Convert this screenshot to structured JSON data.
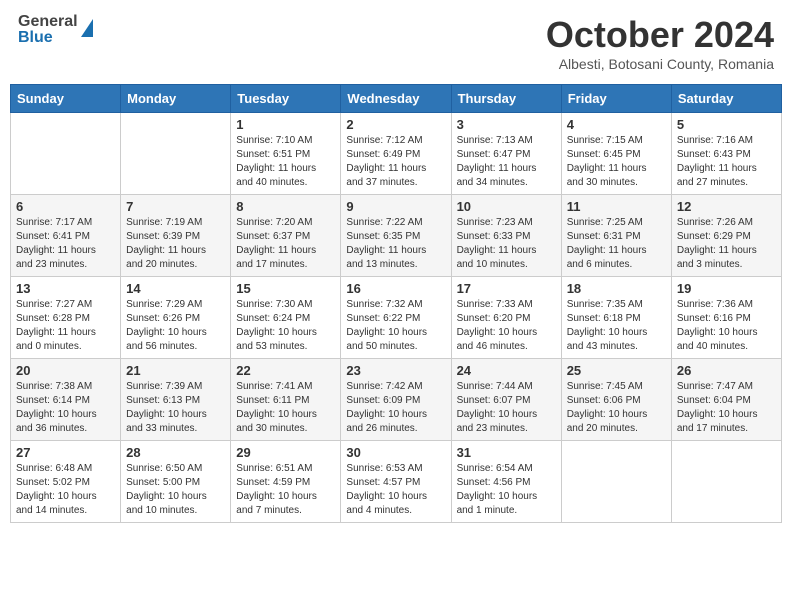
{
  "header": {
    "logo_general": "General",
    "logo_blue": "Blue",
    "month_title": "October 2024",
    "subtitle": "Albesti, Botosani County, Romania"
  },
  "weekdays": [
    "Sunday",
    "Monday",
    "Tuesday",
    "Wednesday",
    "Thursday",
    "Friday",
    "Saturday"
  ],
  "weeks": [
    [
      {
        "day": "",
        "info": ""
      },
      {
        "day": "",
        "info": ""
      },
      {
        "day": "1",
        "info": "Sunrise: 7:10 AM\nSunset: 6:51 PM\nDaylight: 11 hours and 40 minutes."
      },
      {
        "day": "2",
        "info": "Sunrise: 7:12 AM\nSunset: 6:49 PM\nDaylight: 11 hours and 37 minutes."
      },
      {
        "day": "3",
        "info": "Sunrise: 7:13 AM\nSunset: 6:47 PM\nDaylight: 11 hours and 34 minutes."
      },
      {
        "day": "4",
        "info": "Sunrise: 7:15 AM\nSunset: 6:45 PM\nDaylight: 11 hours and 30 minutes."
      },
      {
        "day": "5",
        "info": "Sunrise: 7:16 AM\nSunset: 6:43 PM\nDaylight: 11 hours and 27 minutes."
      }
    ],
    [
      {
        "day": "6",
        "info": "Sunrise: 7:17 AM\nSunset: 6:41 PM\nDaylight: 11 hours and 23 minutes."
      },
      {
        "day": "7",
        "info": "Sunrise: 7:19 AM\nSunset: 6:39 PM\nDaylight: 11 hours and 20 minutes."
      },
      {
        "day": "8",
        "info": "Sunrise: 7:20 AM\nSunset: 6:37 PM\nDaylight: 11 hours and 17 minutes."
      },
      {
        "day": "9",
        "info": "Sunrise: 7:22 AM\nSunset: 6:35 PM\nDaylight: 11 hours and 13 minutes."
      },
      {
        "day": "10",
        "info": "Sunrise: 7:23 AM\nSunset: 6:33 PM\nDaylight: 11 hours and 10 minutes."
      },
      {
        "day": "11",
        "info": "Sunrise: 7:25 AM\nSunset: 6:31 PM\nDaylight: 11 hours and 6 minutes."
      },
      {
        "day": "12",
        "info": "Sunrise: 7:26 AM\nSunset: 6:29 PM\nDaylight: 11 hours and 3 minutes."
      }
    ],
    [
      {
        "day": "13",
        "info": "Sunrise: 7:27 AM\nSunset: 6:28 PM\nDaylight: 11 hours and 0 minutes."
      },
      {
        "day": "14",
        "info": "Sunrise: 7:29 AM\nSunset: 6:26 PM\nDaylight: 10 hours and 56 minutes."
      },
      {
        "day": "15",
        "info": "Sunrise: 7:30 AM\nSunset: 6:24 PM\nDaylight: 10 hours and 53 minutes."
      },
      {
        "day": "16",
        "info": "Sunrise: 7:32 AM\nSunset: 6:22 PM\nDaylight: 10 hours and 50 minutes."
      },
      {
        "day": "17",
        "info": "Sunrise: 7:33 AM\nSunset: 6:20 PM\nDaylight: 10 hours and 46 minutes."
      },
      {
        "day": "18",
        "info": "Sunrise: 7:35 AM\nSunset: 6:18 PM\nDaylight: 10 hours and 43 minutes."
      },
      {
        "day": "19",
        "info": "Sunrise: 7:36 AM\nSunset: 6:16 PM\nDaylight: 10 hours and 40 minutes."
      }
    ],
    [
      {
        "day": "20",
        "info": "Sunrise: 7:38 AM\nSunset: 6:14 PM\nDaylight: 10 hours and 36 minutes."
      },
      {
        "day": "21",
        "info": "Sunrise: 7:39 AM\nSunset: 6:13 PM\nDaylight: 10 hours and 33 minutes."
      },
      {
        "day": "22",
        "info": "Sunrise: 7:41 AM\nSunset: 6:11 PM\nDaylight: 10 hours and 30 minutes."
      },
      {
        "day": "23",
        "info": "Sunrise: 7:42 AM\nSunset: 6:09 PM\nDaylight: 10 hours and 26 minutes."
      },
      {
        "day": "24",
        "info": "Sunrise: 7:44 AM\nSunset: 6:07 PM\nDaylight: 10 hours and 23 minutes."
      },
      {
        "day": "25",
        "info": "Sunrise: 7:45 AM\nSunset: 6:06 PM\nDaylight: 10 hours and 20 minutes."
      },
      {
        "day": "26",
        "info": "Sunrise: 7:47 AM\nSunset: 6:04 PM\nDaylight: 10 hours and 17 minutes."
      }
    ],
    [
      {
        "day": "27",
        "info": "Sunrise: 6:48 AM\nSunset: 5:02 PM\nDaylight: 10 hours and 14 minutes."
      },
      {
        "day": "28",
        "info": "Sunrise: 6:50 AM\nSunset: 5:00 PM\nDaylight: 10 hours and 10 minutes."
      },
      {
        "day": "29",
        "info": "Sunrise: 6:51 AM\nSunset: 4:59 PM\nDaylight: 10 hours and 7 minutes."
      },
      {
        "day": "30",
        "info": "Sunrise: 6:53 AM\nSunset: 4:57 PM\nDaylight: 10 hours and 4 minutes."
      },
      {
        "day": "31",
        "info": "Sunrise: 6:54 AM\nSunset: 4:56 PM\nDaylight: 10 hours and 1 minute."
      },
      {
        "day": "",
        "info": ""
      },
      {
        "day": "",
        "info": ""
      }
    ]
  ]
}
